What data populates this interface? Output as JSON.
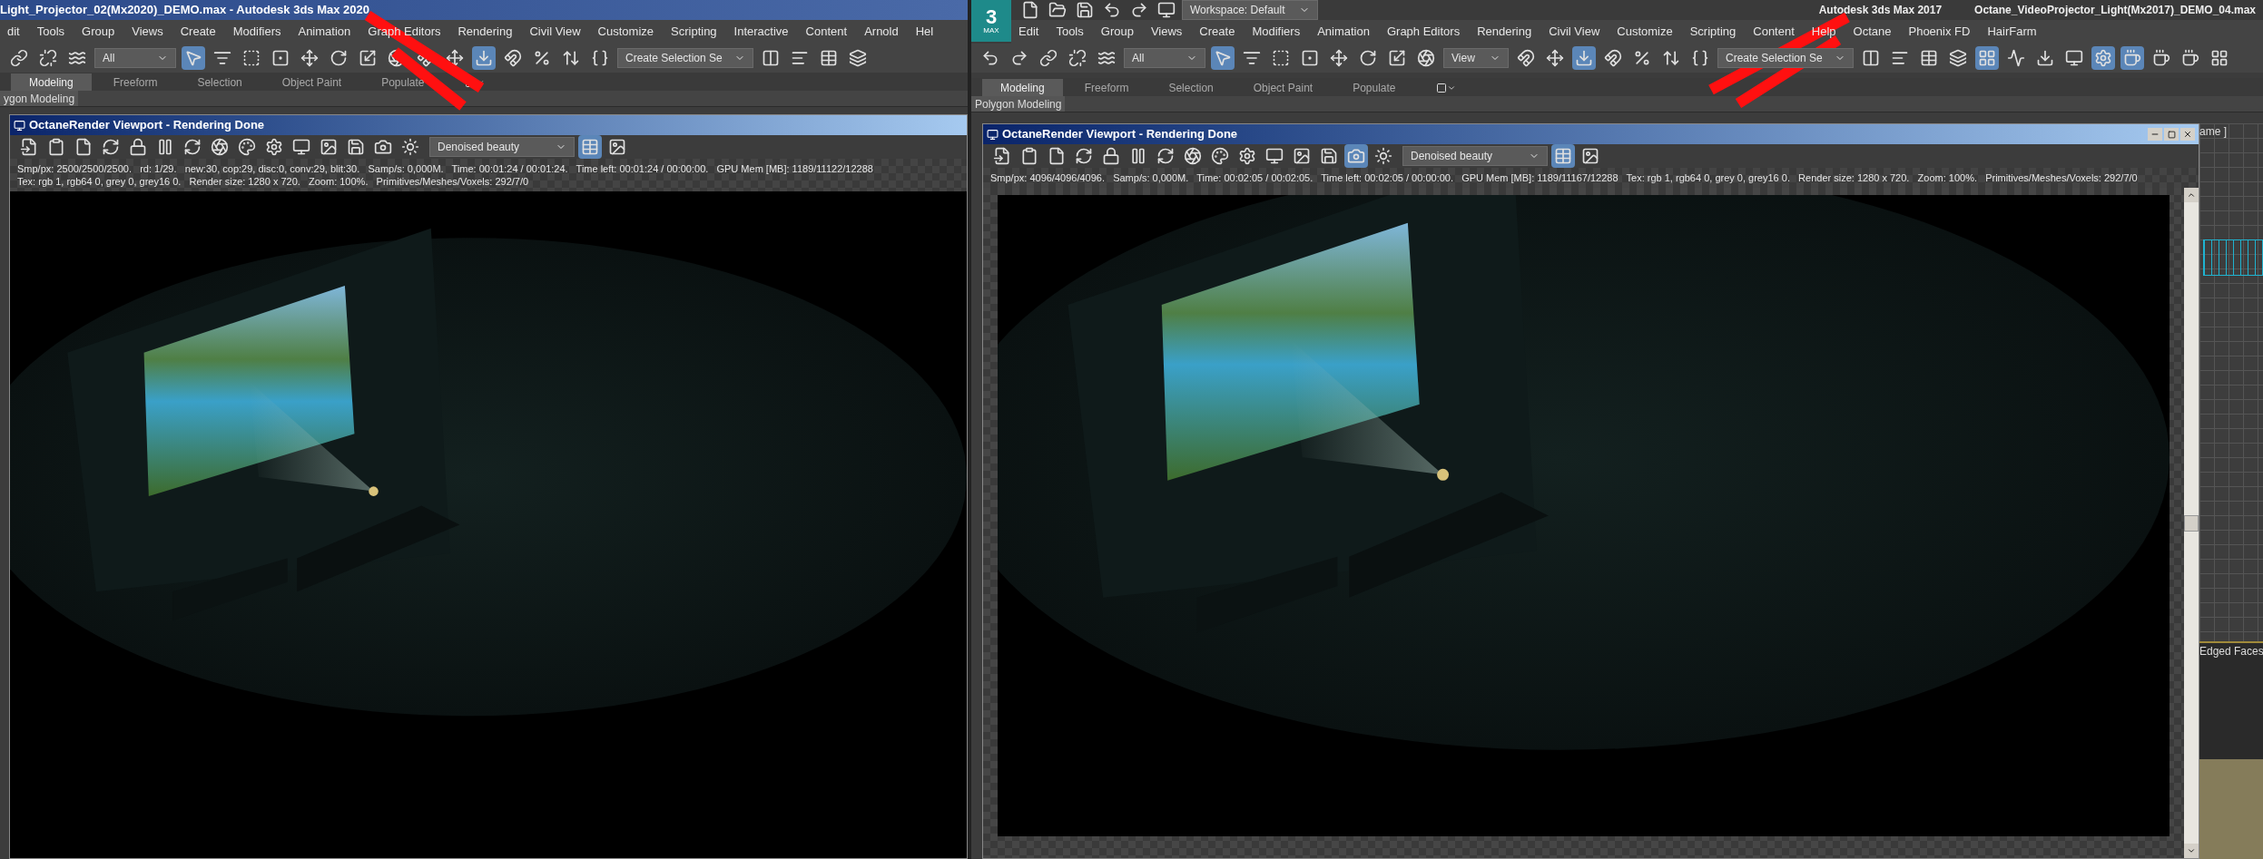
{
  "windows": [
    {
      "kind": "max2020",
      "title": "Light_Projector_02(Mx2020)_DEMO.max - Autodesk 3ds Max 2020",
      "menus": [
        "dit",
        "Tools",
        "Group",
        "Views",
        "Create",
        "Modifiers",
        "Animation",
        "Graph Editors",
        "Rendering",
        "Civil View",
        "Customize",
        "Scripting",
        "Interactive",
        "Content",
        "Arnold",
        "Hel"
      ],
      "toolbar": {
        "selection_filter": "All",
        "named_selection": "Create Selection Se"
      },
      "ribbon_tabs": [
        {
          "label": "Modeling",
          "selected": true
        },
        {
          "label": "Freeform",
          "selected": false
        },
        {
          "label": "Selection",
          "selected": false
        },
        {
          "label": "Object Paint",
          "selected": false
        },
        {
          "label": "Populate",
          "selected": false
        }
      ],
      "panel_label": "ygon Modeling",
      "viewport": {
        "title": "OctaneRender Viewport - Rendering Done",
        "render_pass": "Denoised beauty",
        "status_lines": [
          "Smp/px: 2500/2500/2500.   rd: 1/29.   new:30, cop:29, disc:0, conv:29, blit:30.   Samp/s: 0,000M.   Time: 00:01:24 / 00:01:24.   Time left: 00:01:24 / 00:00:00.   GPU Mem [MB]: 1189/11122/12288",
          "Tex: rgb 1, rgb64 0, grey 0, grey16 0.   Render size: 1280 x 720.   Zoom: 100%.   Primitives/Meshes/Voxels: 292/7/0"
        ]
      }
    },
    {
      "kind": "max2017",
      "app_name": "Autodesk 3ds Max 2017",
      "title": "Octane_VideoProjector_Light(Mx2017)_DEMO_04.max",
      "logo": {
        "mark": "3",
        "caption": "MAX"
      },
      "workspace": "Workspace: Default",
      "menus": [
        "Edit",
        "Tools",
        "Group",
        "Views",
        "Create",
        "Modifiers",
        "Animation",
        "Graph Editors",
        "Rendering",
        "Civil View",
        "Customize",
        "Scripting",
        "Content",
        "Help",
        "Octane",
        "Phoenix FD",
        "HairFarm"
      ],
      "toolbar": {
        "selection_filter": "All",
        "reference_coord": "View",
        "named_selection": "Create Selection Se"
      },
      "ribbon_tabs": [
        {
          "label": "Modeling",
          "selected": true
        },
        {
          "label": "Freeform",
          "selected": false
        },
        {
          "label": "Selection",
          "selected": false
        },
        {
          "label": "Object Paint",
          "selected": false
        },
        {
          "label": "Populate",
          "selected": false
        }
      ],
      "panel_label": "Polygon Modeling",
      "viewport": {
        "title": "OctaneRender Viewport - Rendering Done",
        "render_pass": "Denoised beauty",
        "status_lines": [
          "Smp/px: 4096/4096/4096.   Samp/s: 0,000M.   Time: 00:02:05 / 00:02:05.   Time left: 00:02:05 / 00:00:00.   GPU Mem [MB]: 1189/11167/12288   Tex: rgb 1, rgb64 0, grey 0, grey16 0.   Render size: 1280 x 720.   Zoom: 100%.   Primitives/Meshes/Voxels: 292/7/0"
        ]
      },
      "side_viewport": {
        "label": "ame ]",
        "shading": "Edged Faces"
      }
    }
  ]
}
